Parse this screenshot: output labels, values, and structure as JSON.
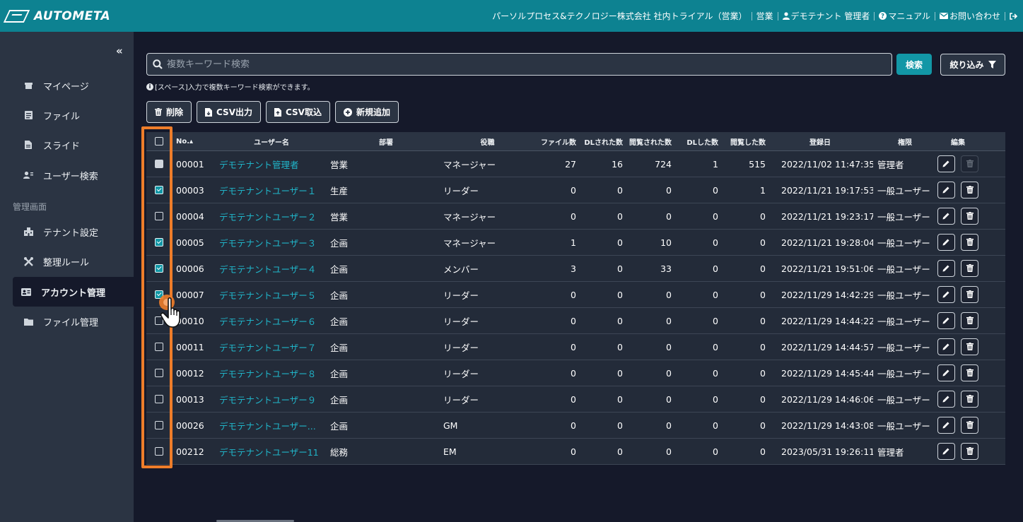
{
  "header": {
    "logo": "AUTOMETA",
    "company": "パーソルプロセス&テクノロジー株式会社 社内トライアル（営業）",
    "department": "営業",
    "user": "デモテナント 管理者",
    "manual": "マニュアル",
    "contact": "お問い合わせ"
  },
  "sidebar": {
    "collapse": "«",
    "section_label": "管理画面",
    "items": [
      {
        "label": "マイページ",
        "icon": "home-icon"
      },
      {
        "label": "ファイル",
        "icon": "file-icon"
      },
      {
        "label": "スライド",
        "icon": "slide-icon"
      },
      {
        "label": "ユーザー検索",
        "icon": "user-search-icon"
      },
      {
        "label": "テナント設定",
        "icon": "building-icon"
      },
      {
        "label": "整理ルール",
        "icon": "tools-icon"
      },
      {
        "label": "アカウント管理",
        "icon": "id-card-icon"
      },
      {
        "label": "ファイル管理",
        "icon": "folder-icon"
      }
    ]
  },
  "search": {
    "placeholder": "複数キーワード検索",
    "search_button": "検索",
    "filter_button": "絞り込み",
    "hint": "[スペース]入力で複数キーワード検索ができます。"
  },
  "toolbar": {
    "delete": "削除",
    "csv_export": "CSV出力",
    "csv_import": "CSV取込",
    "add_new": "新規追加"
  },
  "table": {
    "headers": [
      "No.",
      "ユーザー名",
      "部署",
      "役職",
      "ファイル数",
      "DLされた数",
      "閲覧された数",
      "DLした数",
      "閲覧した数",
      "登録日",
      "権限",
      "編集"
    ],
    "sort_indicator": "▴",
    "rows": [
      {
        "no": "00001",
        "name": "デモテナント管理者",
        "dept": "営業",
        "role": "マネージャー",
        "files": "27",
        "dl_received": "16",
        "viewed_received": "724",
        "dl_done": "1",
        "viewed_done": "515",
        "date": "2022/11/02 11:47:35",
        "perm": "管理者",
        "check": "dis"
      },
      {
        "no": "00003",
        "name": "デモテナントユーザー１",
        "dept": "生産",
        "role": "リーダー",
        "files": "0",
        "dl_received": "0",
        "viewed_received": "0",
        "dl_done": "0",
        "viewed_done": "1",
        "date": "2022/11/21 19:17:53",
        "perm": "一般ユーザー",
        "check": "on"
      },
      {
        "no": "00004",
        "name": "デモテナントユーザー２",
        "dept": "営業",
        "role": "マネージャー",
        "files": "0",
        "dl_received": "0",
        "viewed_received": "0",
        "dl_done": "0",
        "viewed_done": "0",
        "date": "2022/11/21 19:23:17",
        "perm": "一般ユーザー",
        "check": "un"
      },
      {
        "no": "00005",
        "name": "デモテナントユーザー３",
        "dept": "企画",
        "role": "マネージャー",
        "files": "1",
        "dl_received": "0",
        "viewed_received": "10",
        "dl_done": "0",
        "viewed_done": "0",
        "date": "2022/11/21 19:28:04",
        "perm": "一般ユーザー",
        "check": "on"
      },
      {
        "no": "00006",
        "name": "デモテナントユーザー４",
        "dept": "企画",
        "role": "メンバー",
        "files": "3",
        "dl_received": "0",
        "viewed_received": "33",
        "dl_done": "0",
        "viewed_done": "0",
        "date": "2022/11/21 19:51:06",
        "perm": "一般ユーザー",
        "check": "on"
      },
      {
        "no": "00007",
        "name": "デモテナントユーザー５",
        "dept": "企画",
        "role": "リーダー",
        "files": "0",
        "dl_received": "0",
        "viewed_received": "0",
        "dl_done": "0",
        "viewed_done": "0",
        "date": "2022/11/29 14:42:29",
        "perm": "一般ユーザー",
        "check": "on"
      },
      {
        "no": "00010",
        "name": "デモテナントユーザー６",
        "dept": "企画",
        "role": "リーダー",
        "files": "0",
        "dl_received": "0",
        "viewed_received": "0",
        "dl_done": "0",
        "viewed_done": "0",
        "date": "2022/11/29 14:44:22",
        "perm": "一般ユーザー",
        "check": "un"
      },
      {
        "no": "00011",
        "name": "デモテナントユーザー７",
        "dept": "企画",
        "role": "リーダー",
        "files": "0",
        "dl_received": "0",
        "viewed_received": "0",
        "dl_done": "0",
        "viewed_done": "0",
        "date": "2022/11/29 14:44:57",
        "perm": "一般ユーザー",
        "check": "un"
      },
      {
        "no": "00012",
        "name": "デモテナントユーザー８",
        "dept": "企画",
        "role": "リーダー",
        "files": "0",
        "dl_received": "0",
        "viewed_received": "0",
        "dl_done": "0",
        "viewed_done": "0",
        "date": "2022/11/29 14:45:44",
        "perm": "一般ユーザー",
        "check": "un"
      },
      {
        "no": "00013",
        "name": "デモテナントユーザー９",
        "dept": "企画",
        "role": "リーダー",
        "files": "0",
        "dl_received": "0",
        "viewed_received": "0",
        "dl_done": "0",
        "viewed_done": "0",
        "date": "2022/11/29 14:46:06",
        "perm": "一般ユーザー",
        "check": "un"
      },
      {
        "no": "00026",
        "name": "デモテナントユーザー...",
        "dept": "企画",
        "role": "GM",
        "files": "0",
        "dl_received": "0",
        "viewed_received": "0",
        "dl_done": "0",
        "viewed_done": "0",
        "date": "2022/11/29 14:43:08",
        "perm": "一般ユーザー",
        "check": "un"
      },
      {
        "no": "00212",
        "name": "デモテナントユーザー11",
        "dept": "総務",
        "role": "EM",
        "files": "0",
        "dl_received": "0",
        "viewed_received": "0",
        "dl_done": "0",
        "viewed_done": "0",
        "date": "2023/05/31 19:26:11",
        "perm": "管理者",
        "check": "un"
      }
    ]
  },
  "colors": {
    "header_bg": "#0d8291",
    "sidebar_bg": "#2b3443",
    "page_bg": "#15192a",
    "link": "#20b4c8",
    "highlight": "#ee7d2a"
  }
}
